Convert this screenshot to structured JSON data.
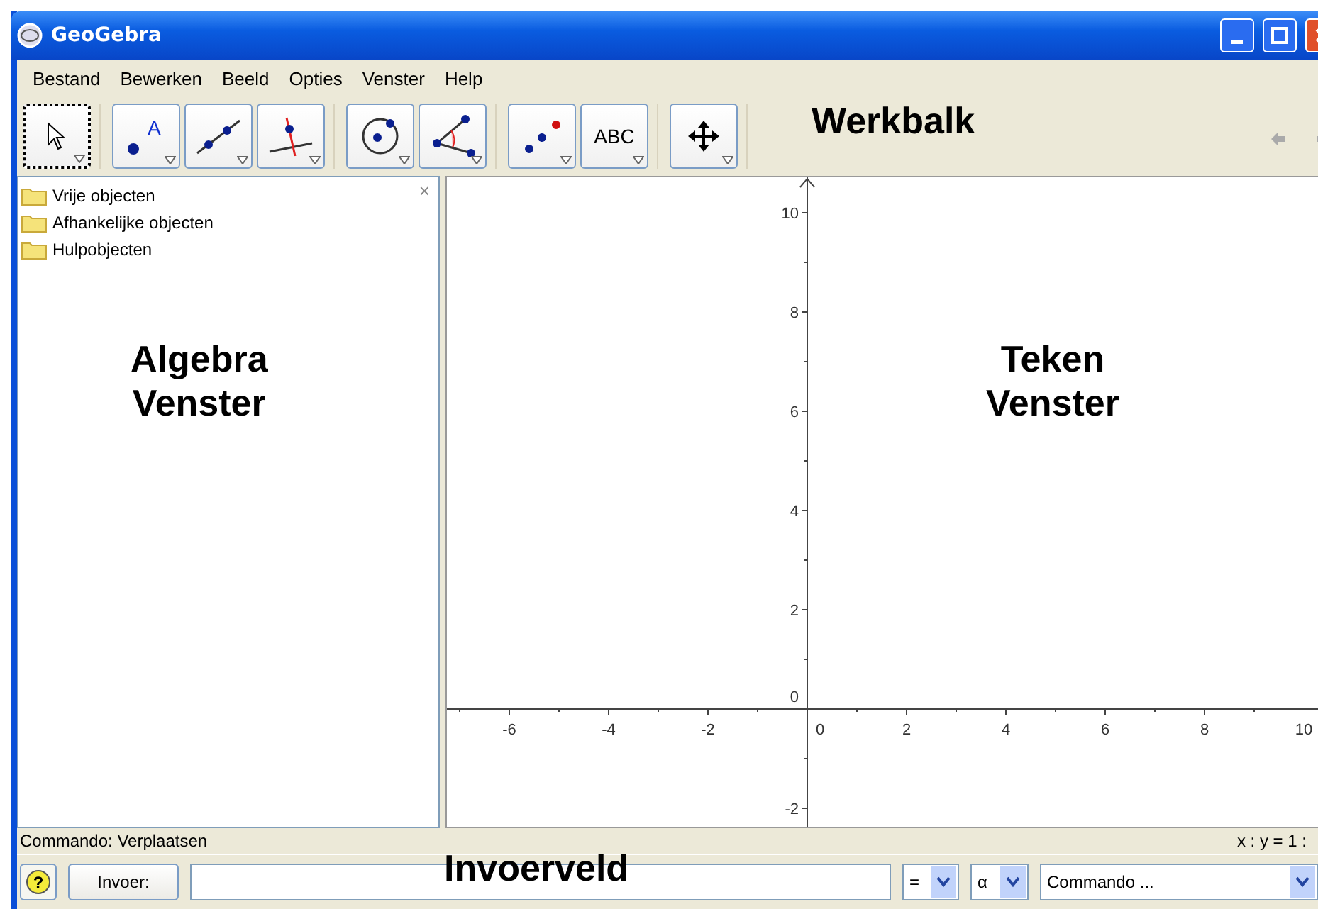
{
  "window": {
    "title": "GeoGebra"
  },
  "menu": [
    "Bestand",
    "Bewerken",
    "Beeld",
    "Opties",
    "Venster",
    "Help"
  ],
  "tools": [
    {
      "kind": "move",
      "selected": true
    },
    {
      "kind": "point",
      "label": "A",
      "selected": false
    },
    {
      "kind": "line",
      "selected": false
    },
    {
      "kind": "perpendicular",
      "selected": false
    },
    {
      "kind": "circle",
      "selected": false
    },
    {
      "kind": "angle",
      "selected": false
    },
    {
      "kind": "reflect",
      "selected": false
    },
    {
      "kind": "text",
      "label": "ABC",
      "selected": false
    },
    {
      "kind": "pan",
      "selected": false
    }
  ],
  "algebra": {
    "close": "×",
    "items": [
      "Vrije objecten",
      "Afhankelijke objecten",
      "Hulpobjecten"
    ]
  },
  "graphics": {
    "x_labels": [
      "-6",
      "-4",
      "-2",
      "0",
      "2",
      "4",
      "6",
      "8",
      "10"
    ],
    "y_labels": [
      "10",
      "8",
      "6",
      "4",
      "2",
      "0",
      "-2"
    ]
  },
  "status_bar": {
    "left": "Commando: Verplaatsen",
    "right": "x : y = 1 :"
  },
  "input_bar": {
    "help": "?",
    "button": "Invoer:",
    "symbol_select": "=",
    "greek_select": "α",
    "command_select": "Commando ..."
  },
  "annotations": {
    "toolbar": "Werkbalk",
    "algebra": "Algebra\nVenster",
    "graphics": "Teken\nVenster",
    "input": "Invoerveld"
  }
}
